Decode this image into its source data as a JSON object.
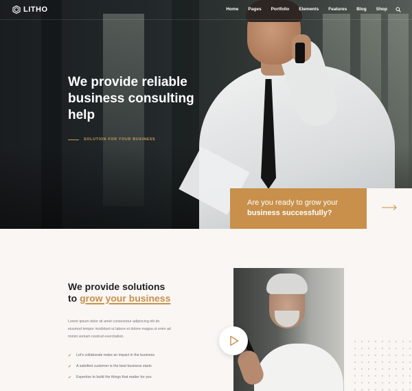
{
  "brand": {
    "name": "LITHO",
    "accent": "#c8904a"
  },
  "nav": {
    "items": [
      "Home",
      "Pages",
      "Portfolio",
      "Elements",
      "Features",
      "Blog",
      "Shop"
    ],
    "search_icon": "search-icon"
  },
  "hero": {
    "title": "We provide reliable business consulting help",
    "subtitle": "SOLUTION FOR YOUR BUSINESS"
  },
  "cta": {
    "line1": "Are you ready to grow your",
    "line2": "business successfully?",
    "arrow_icon": "arrow-right-icon"
  },
  "section": {
    "title_line1": "We provide solutions",
    "title_prefix": "to",
    "title_accent": "grow your business",
    "paragraph": "Lorem ipsum dolor sit amet consectetur adipiscing elit do eiusmod tempor incididunt ut labore et dolore magna ut enim ad minim veniam nostrud exercitation.",
    "checklist": [
      "Let's collaborate make an impact in the business",
      "A satisfied customer is the best business starts",
      "Expertise to build the things that matter for you"
    ],
    "play_icon": "play-icon"
  }
}
